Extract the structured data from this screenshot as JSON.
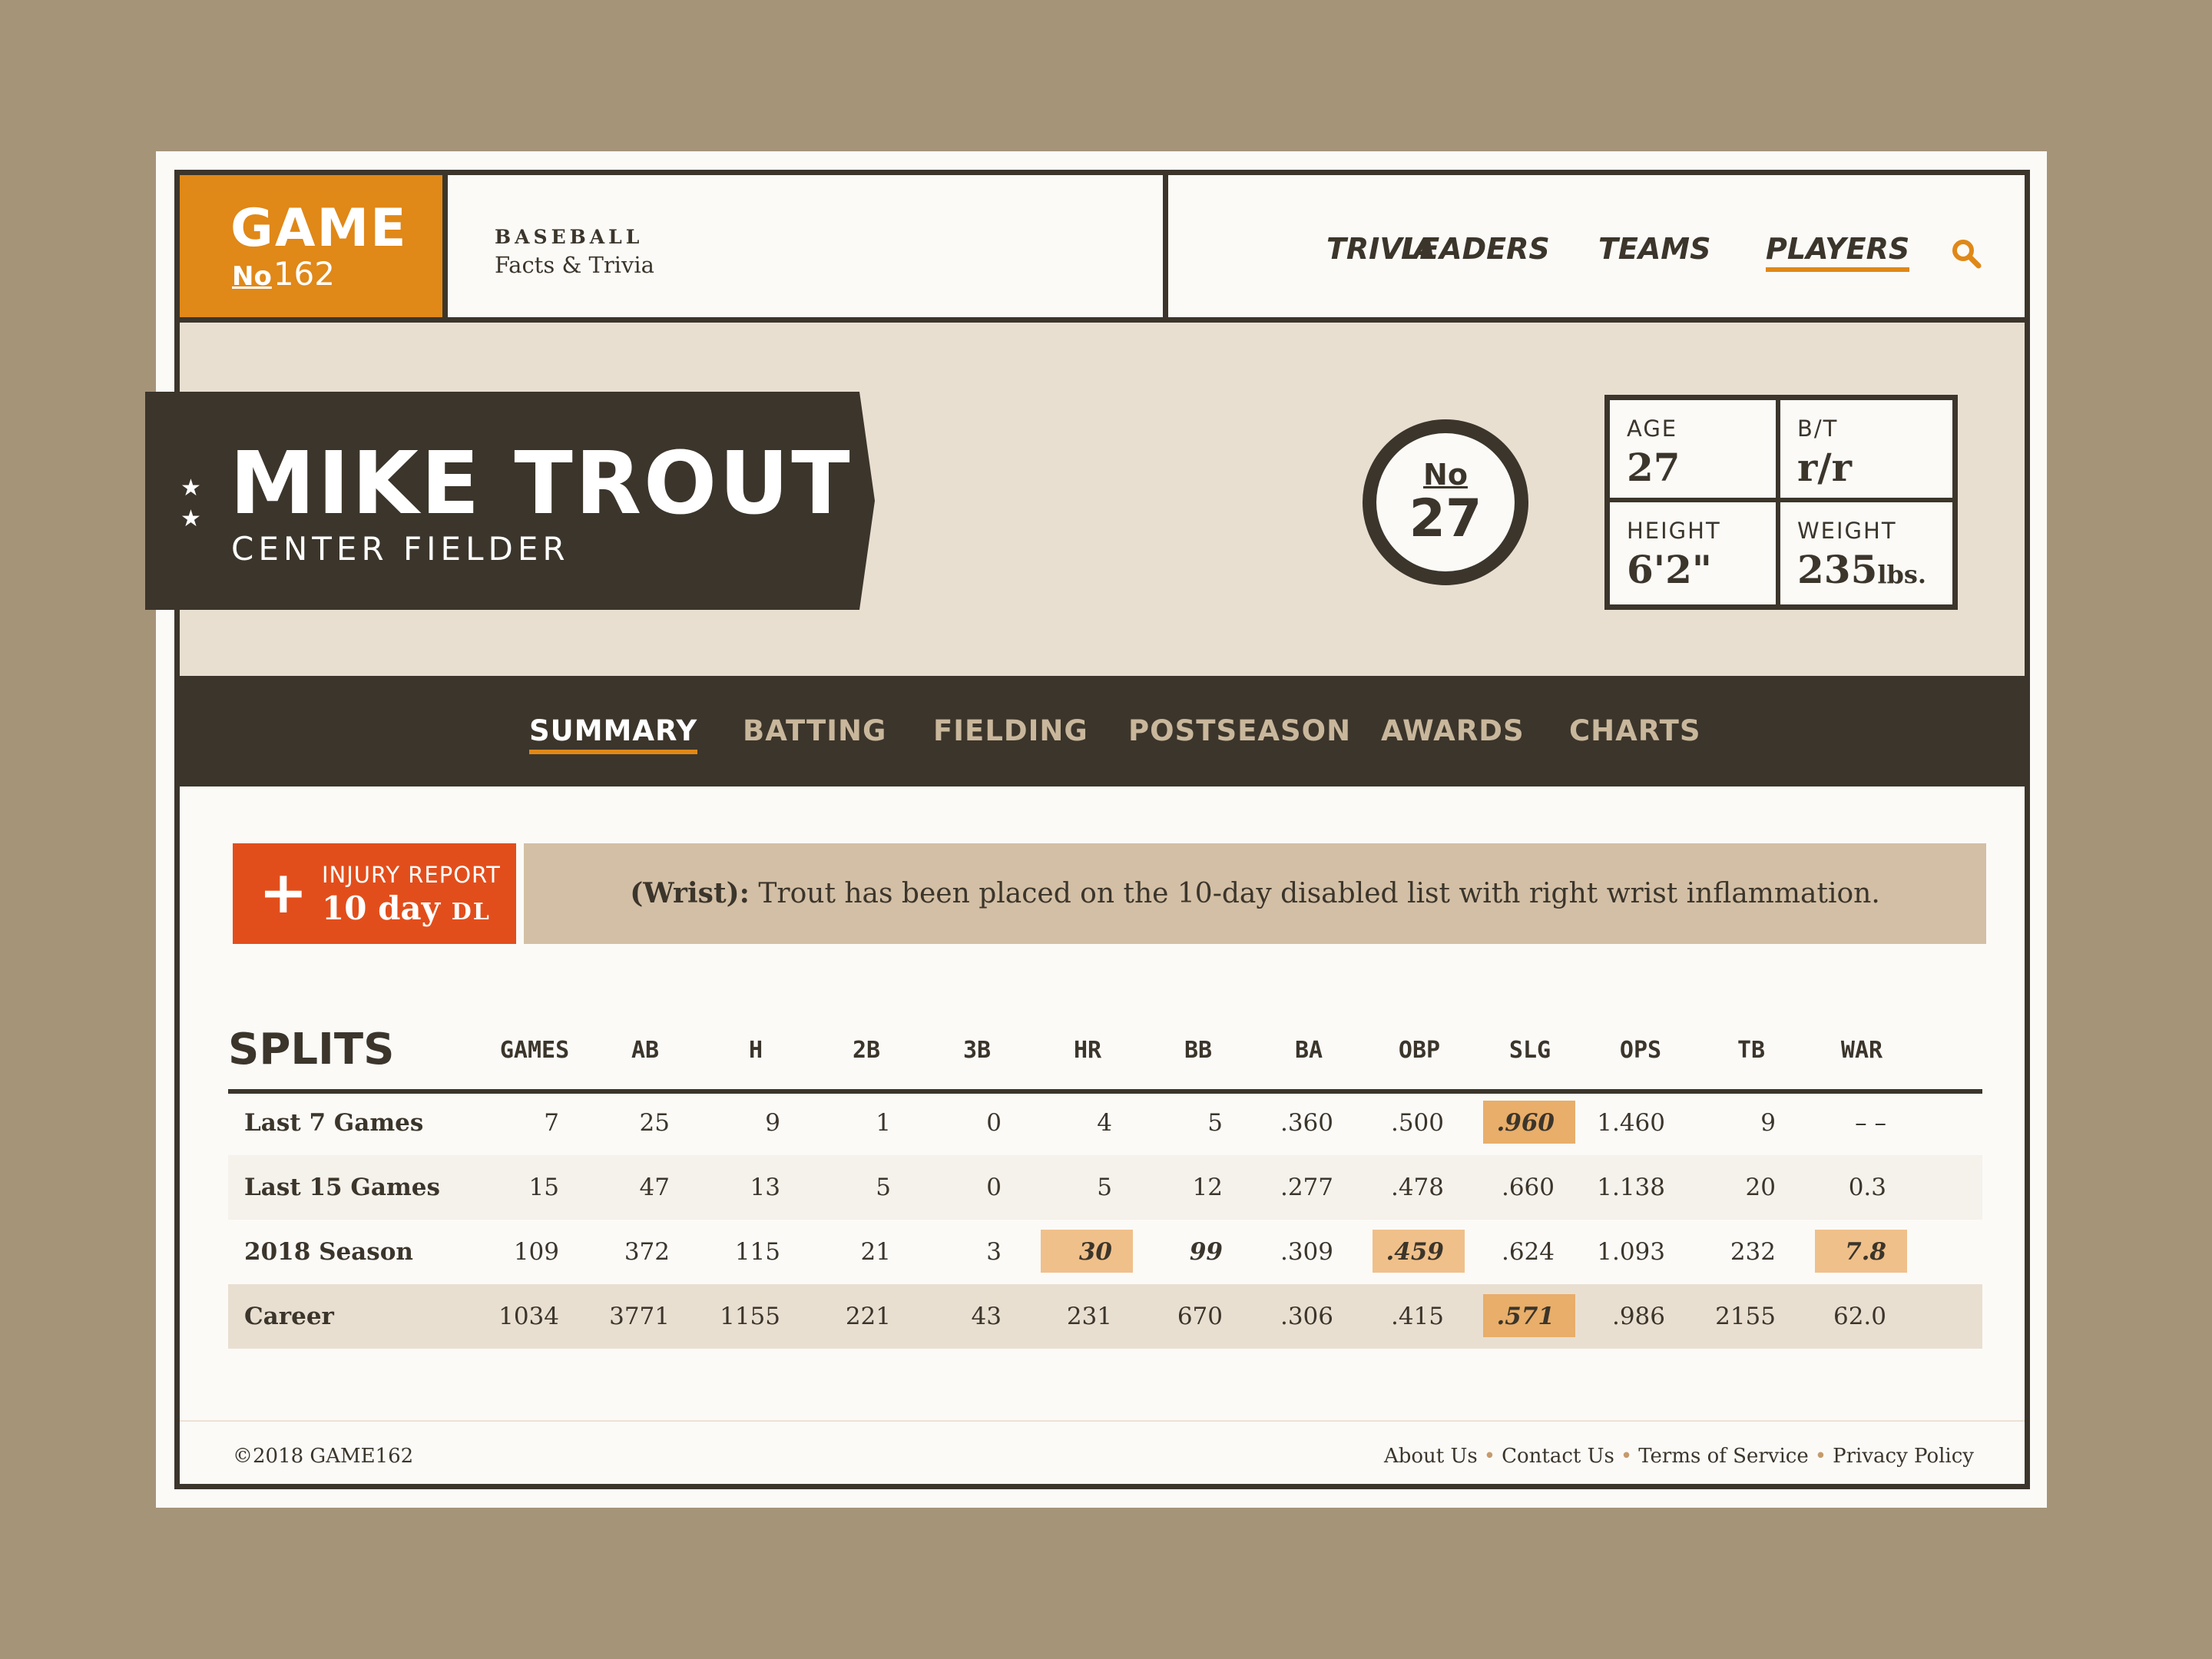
{
  "brand": {
    "name": "GAME",
    "number_prefix": "No",
    "number": "162",
    "tag_sport": "BASEBALL",
    "tag_sub": "Facts & Trivia"
  },
  "nav": {
    "items": [
      "TRIVIA",
      "LEADERS",
      "TEAMS",
      "PLAYERS"
    ],
    "active": "PLAYERS",
    "search_icon": "search-icon"
  },
  "player": {
    "name": "MIKE TROUT",
    "position": "CENTER FIELDER",
    "stars": "★\n★",
    "jersey_prefix": "No",
    "jersey_number": "27",
    "bio": {
      "age_label": "AGE",
      "age": "27",
      "bt_label": "B/T",
      "bt": "r/r",
      "height_label": "HEIGHT",
      "height": "6'2\"",
      "weight_label": "WEIGHT",
      "weight": "235",
      "weight_unit": "lbs."
    }
  },
  "tabs": {
    "items": [
      "SUMMARY",
      "BATTING",
      "FIELDING",
      "POSTSEASON",
      "AWARDS",
      "CHARTS"
    ],
    "active": "SUMMARY"
  },
  "injury": {
    "label": "INJURY REPORT",
    "duration": "10 day",
    "duration_unit": "DL",
    "body_part": "(Wrist):",
    "text": "Trout has been placed on the 10-day disabled list with right wrist inflammation."
  },
  "splits": {
    "title": "SPLITS",
    "columns": [
      "GAMES",
      "AB",
      "H",
      "2B",
      "3B",
      "HR",
      "BB",
      "BA",
      "OBP",
      "SLG",
      "OPS",
      "TB",
      "WAR"
    ],
    "rows": [
      {
        "label": "Last 7 Games",
        "values": [
          "7",
          "25",
          "9",
          "1",
          "0",
          "4",
          "5",
          ".360",
          ".500",
          ".960",
          "1.460",
          "9",
          "– –"
        ]
      },
      {
        "label": "Last 15 Games",
        "values": [
          "15",
          "47",
          "13",
          "5",
          "0",
          "5",
          "12",
          ".277",
          ".478",
          ".660",
          "1.138",
          "20",
          "0.3"
        ]
      },
      {
        "label": "2018 Season",
        "values": [
          "109",
          "372",
          "115",
          "21",
          "3",
          "30",
          "99",
          ".309",
          ".459",
          ".624",
          "1.093",
          "232",
          "7.8"
        ]
      },
      {
        "label": "Career",
        "values": [
          "1034",
          "3771",
          "1155",
          "221",
          "43",
          "231",
          "670",
          ".306",
          ".415",
          ".571",
          ".986",
          "2155",
          "62.0"
        ]
      }
    ]
  },
  "footer": {
    "copyright": "©2018 GAME162",
    "links": [
      "About Us",
      "Contact Us",
      "Terms of Service",
      "Privacy Policy"
    ]
  },
  "colors": {
    "dark": "#3b352b",
    "orange": "#e08818",
    "injury": "#e24e1b",
    "highlight": "#f0c08a",
    "hero_bg": "#e9dfd1",
    "page_bg": "#a69479"
  }
}
